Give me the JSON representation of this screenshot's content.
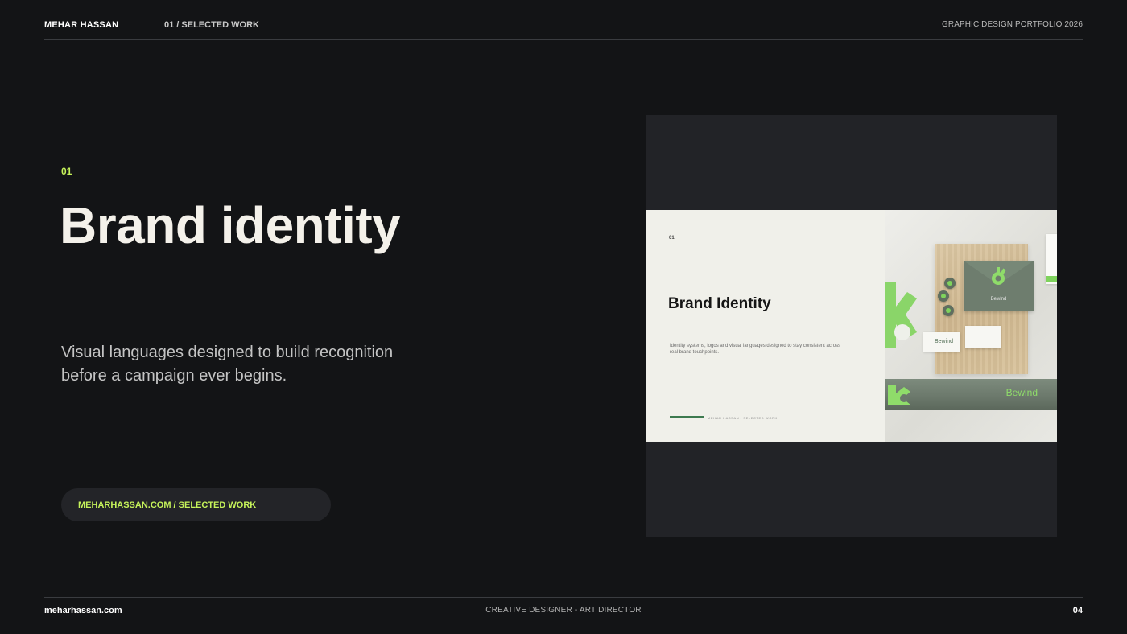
{
  "header": {
    "brand": "MEHAR HASSAN",
    "section": "01 / SELECTED WORK",
    "portfolio": "GRAPHIC DESIGN PORTFOLIO 2026"
  },
  "main": {
    "number": "01",
    "title": "Brand identity",
    "description": "Visual languages designed to build recognition before a campaign ever begins.",
    "link": "MEHARHASSAN.COM / SELECTED WORK"
  },
  "preview": {
    "slide": {
      "number": "01",
      "title": "Brand Identity",
      "description": "Identity systems, logos and visual languages designed to stay consistent across real brand touchpoints.",
      "footer": "MEHAR HASSAN  /  SELECTED WORK"
    },
    "mockup": {
      "brand_word": "Bewind",
      "card_word": "Bewind",
      "tube_word": "Bewind"
    }
  },
  "footer": {
    "site": "meharhassan.com",
    "role": "CREATIVE DESIGNER - ART DIRECTOR",
    "page": "04"
  },
  "colors": {
    "background": "#131416",
    "accent": "#c6f35a",
    "card": "#222327",
    "slide": "#f0f0ea",
    "brand_green": "#7fd35c"
  }
}
